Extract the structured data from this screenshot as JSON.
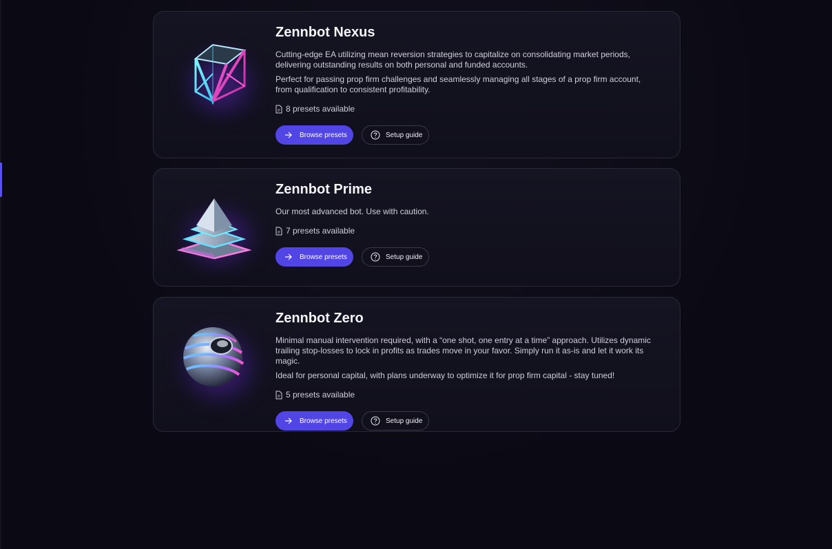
{
  "bots": [
    {
      "name": "Zennbot Nexus",
      "desc1": "Cutting-edge EA utilizing mean reversion strategies to capitalize on consolidating market periods, delivering outstanding results on both personal and funded accounts.",
      "desc2": "Perfect for passing prop firm challenges and seamlessly managing all stages of a prop firm account, from qualification to consistent profitability.",
      "presets": "8 presets available",
      "browse_label": "Browse presets",
      "guide_label": "Setup guide",
      "art": "wireframe-cube"
    },
    {
      "name": "Zennbot Prime",
      "desc1": "Our most advanced bot. Use with caution.",
      "presets": "7 presets available",
      "browse_label": "Browse presets",
      "guide_label": "Setup guide",
      "art": "layered-pyramid"
    },
    {
      "name": "Zennbot Zero",
      "desc1": "Minimal manual intervention required, with a “one shot, one entry at a time” approach. Utilizes dynamic trailing stop-losses to lock in profits as trades move in your favor. Simply run it as-is and let it work its magic.",
      "desc2": "Ideal for personal capital, with plans underway to optimize it for prop firm capital - stay tuned!",
      "presets": "5 presets available",
      "browse_label": "Browse presets",
      "guide_label": "Setup guide",
      "art": "chrome-sphere"
    }
  ],
  "icons": {
    "browse": "arrow-right-icon",
    "guide": "question-circle-icon",
    "presets": "file-icon"
  },
  "colors": {
    "accent": "#5145e6",
    "background": "#0b0a14",
    "card": "#131220",
    "border": "#2a2938"
  }
}
